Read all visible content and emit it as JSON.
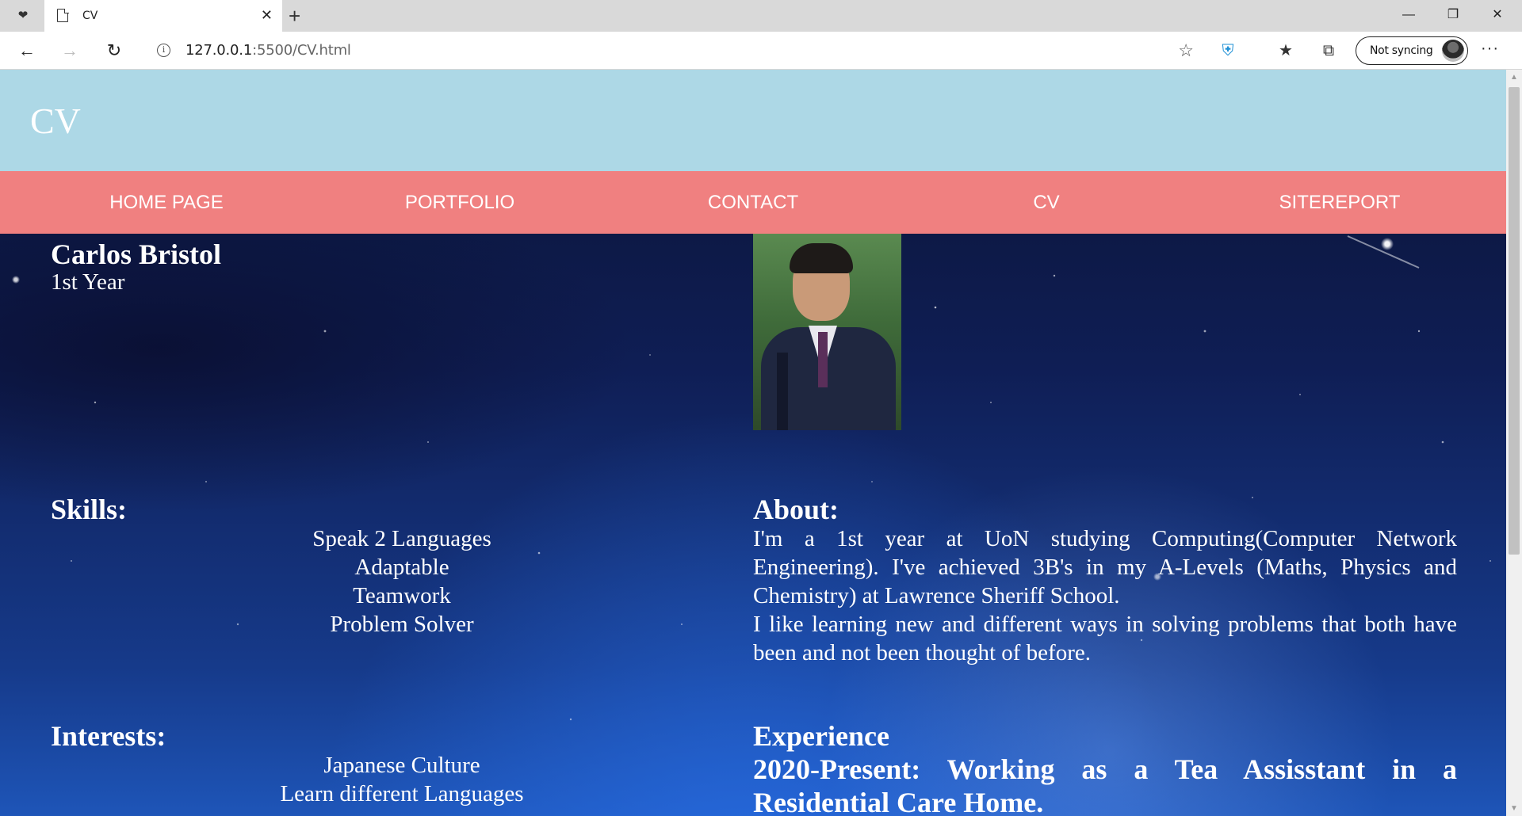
{
  "browser": {
    "tab_title": "CV",
    "url_host": "127.0.0.1",
    "url_rest": ":5500/CV.html",
    "sync_label": "Not syncing",
    "icons": [
      "tab-actions-icon",
      "page-icon",
      "close-icon",
      "plus-icon",
      "minimize-icon",
      "restore-icon",
      "close-window-icon",
      "back-arrow-icon",
      "forward-arrow-icon",
      "refresh-icon",
      "info-icon",
      "star-icon",
      "shield-icon",
      "favorites-icon",
      "collections-icon",
      "more-icon"
    ]
  },
  "site": {
    "title": "CV",
    "nav": [
      "HOME PAGE",
      "PORTFOLIO",
      "CONTACT",
      "CV",
      "SITEREPORT"
    ],
    "colors": {
      "header": "#add8e6",
      "nav": "#f08080"
    }
  },
  "profile": {
    "name": "Carlos Bristol",
    "year": "1st Year"
  },
  "skills": {
    "title": "Skills:",
    "items": [
      "Speak 2 Languages",
      "Adaptable",
      "Teamwork",
      "Problem Solver"
    ]
  },
  "interests": {
    "title": "Interests:",
    "items": [
      "Japanese Culture",
      "Learn different Languages"
    ]
  },
  "about": {
    "title": "About:",
    "paragraphs": [
      "I'm a 1st year at UoN studying Computing(Computer Network Engineering). I've achieved 3B's in my A-Levels (Maths, Physics and Chemistry) at Lawrence Sheriff School.",
      "I like learning new and different ways in solving problems that both have been and not been thought of before."
    ]
  },
  "experience": {
    "title": "Experience",
    "entry": "2020-Present: Working as a Tea Assisstant in a Residential Care Home."
  }
}
